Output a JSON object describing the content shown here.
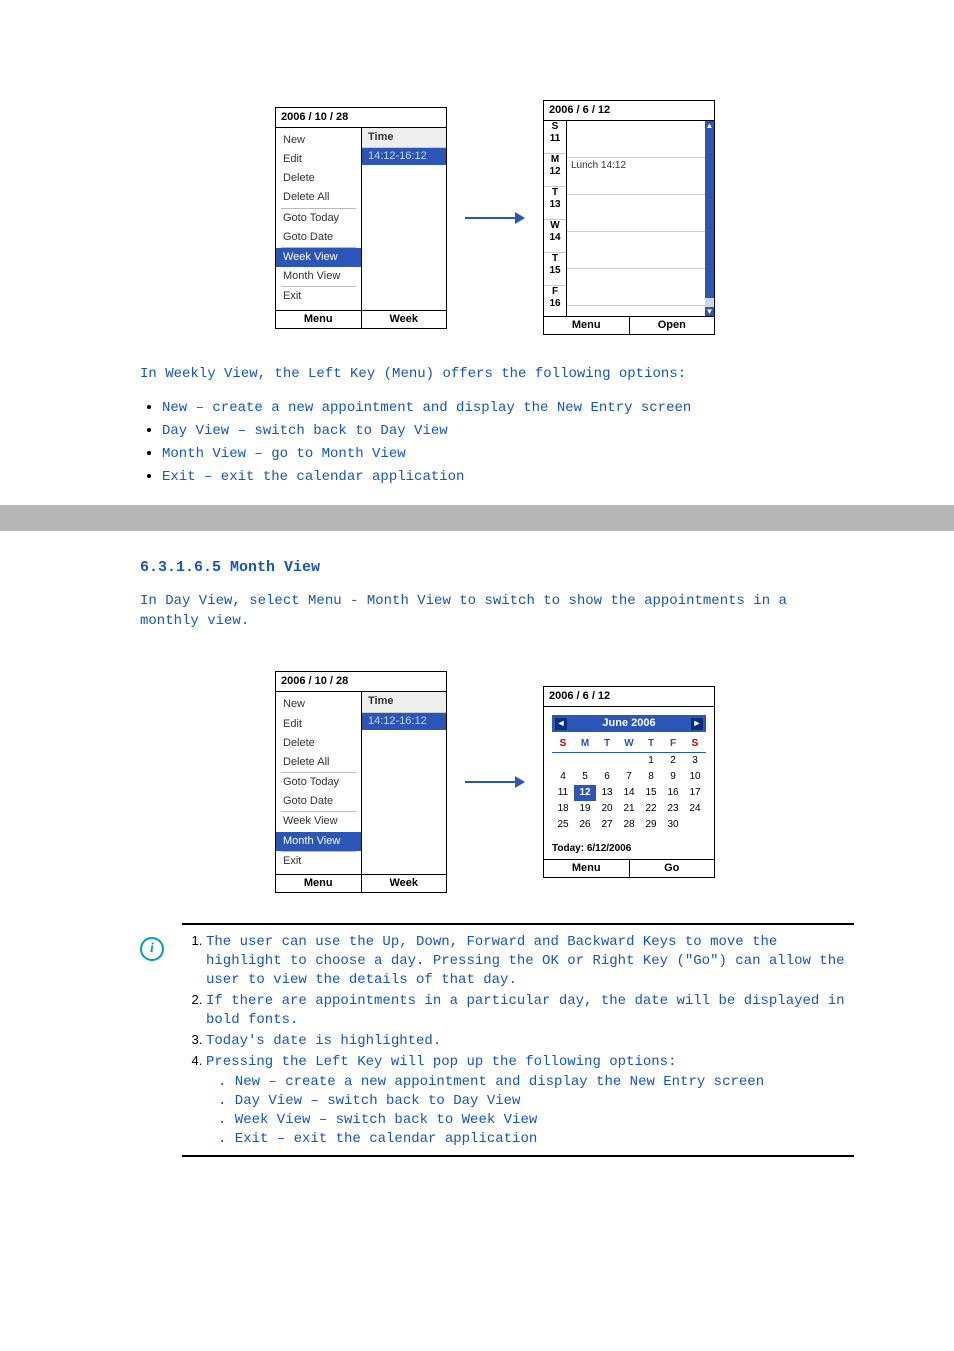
{
  "s1": {
    "title": "2006 / 10 / 28",
    "menu": [
      "New",
      "Edit",
      "Delete",
      "Delete All",
      "Goto Today",
      "Goto Date",
      "Week View",
      "Month View",
      "Exit"
    ],
    "hl": "Week View",
    "col_head": "Time",
    "appt": "14:12-16:12",
    "sk_left": "Menu",
    "sk_right": "Week"
  },
  "s2": {
    "title": "2006 / 6 / 12",
    "days": [
      {
        "d": "S",
        "n": "11"
      },
      {
        "d": "M",
        "n": "12",
        "row": "Lunch    14:12"
      },
      {
        "d": "T",
        "n": "13"
      },
      {
        "d": "W",
        "n": "14"
      },
      {
        "d": "T",
        "n": "15"
      },
      {
        "d": "F",
        "n": "16"
      }
    ],
    "sk_left": "Menu",
    "sk_right": "Open"
  },
  "intro": "In Weekly View, the Left Key (Menu) offers the following options:",
  "bullets": [
    "New – create a new appointment and display the New Entry screen",
    "Day View – switch back to Day View",
    "Month View – go to Month View",
    "Exit – exit the calendar application"
  ],
  "heading": "6.3.1.6.5 Month View",
  "para_after": "In Day View, select Menu - Month View to switch to show the appointments in a monthly view.",
  "s3": {
    "title": "2006 / 10 / 28",
    "menu": [
      "New",
      "Edit",
      "Delete",
      "Delete All",
      "Goto Today",
      "Goto Date",
      "Week View",
      "Month View",
      "Exit"
    ],
    "hl": "Month View",
    "col_head": "Time",
    "appt": "14:12-16:12",
    "sk_left": "Menu",
    "sk_right": "Week"
  },
  "s4": {
    "title": "2006 / 6 / 12",
    "month_label": "June 2006",
    "dow": [
      "S",
      "M",
      "T",
      "W",
      "T",
      "F",
      "S"
    ],
    "grid": [
      [
        "",
        "",
        "",
        "",
        "1",
        "2",
        "3"
      ],
      [
        "4",
        "5",
        "6",
        "7",
        "8",
        "9",
        "10"
      ],
      [
        "11",
        "12",
        "13",
        "14",
        "15",
        "16",
        "17"
      ],
      [
        "18",
        "19",
        "20",
        "21",
        "22",
        "23",
        "24"
      ],
      [
        "25",
        "26",
        "27",
        "28",
        "29",
        "30",
        ""
      ]
    ],
    "selected": "12",
    "today_line": "Today: 6/12/2006",
    "sk_left": "Menu",
    "sk_right": "Go"
  },
  "notes": {
    "n1": "The user can use the Up, Down, Forward and Backward Keys to move the highlight to choose a day. Pressing the OK or Right Key (\"Go\") can allow the user to view the details of that day.",
    "n2": "If there are appointments in a particular day, the date will be displayed in bold fonts.",
    "n3": "Today's date is highlighted.",
    "n4": "Pressing the Left Key will pop up the following options:",
    "subs": [
      ". New – create a new appointment and display the New Entry screen",
      ". Day View – switch back to Day View",
      ". Week View – switch back to Week View",
      ". Exit – exit the calendar application"
    ]
  }
}
